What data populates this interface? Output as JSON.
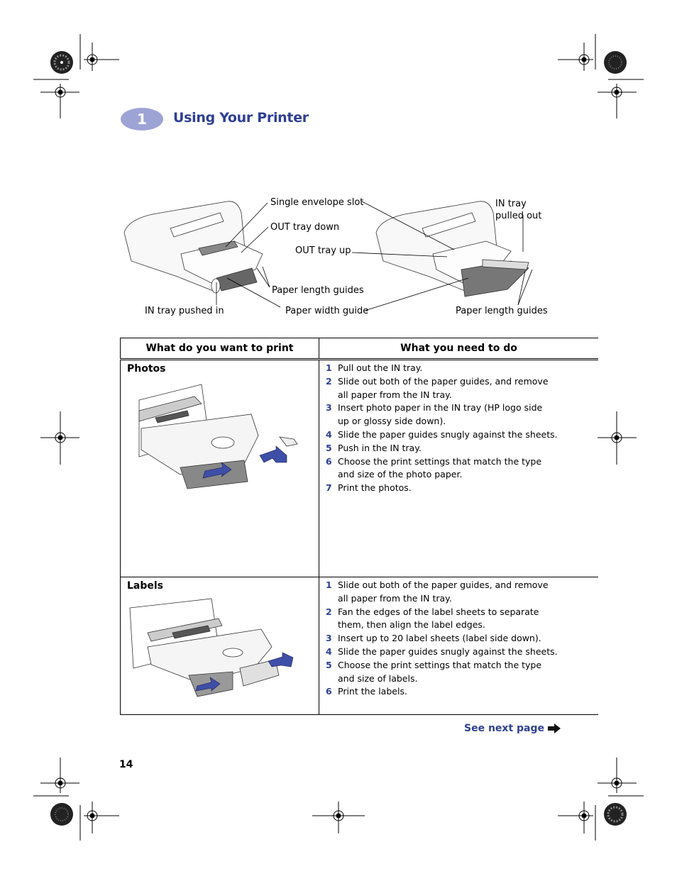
{
  "chapter": {
    "number": "1",
    "title": "Using Your Printer"
  },
  "figure": {
    "callouts": {
      "single_envelope_slot": "Single envelope slot",
      "out_tray_down": "OUT tray down",
      "out_tray_up": "OUT tray up",
      "paper_length_guides_left": "Paper length guides",
      "in_tray_pushed_in": "IN tray pushed in",
      "paper_width_guide": "Paper width guide",
      "in_tray_pulled_out": [
        "IN tray",
        "pulled out"
      ],
      "paper_length_guides_right": "Paper length guides"
    }
  },
  "table": {
    "headers": [
      "What do you want to print",
      "What you need to do"
    ],
    "rows": [
      {
        "item": "Photos",
        "steps": [
          {
            "n": "1",
            "text": "Pull out the IN tray."
          },
          {
            "n": "2",
            "text": "Slide out both of the paper guides, and remove all paper from the IN tray."
          },
          {
            "n": "3",
            "text": "Insert photo paper in the IN tray (HP logo side up or glossy side down)."
          },
          {
            "n": "4",
            "text": "Slide the paper guides snugly against the sheets."
          },
          {
            "n": "5",
            "text": "Push in the IN tray."
          },
          {
            "n": "6",
            "text": "Choose the print settings that match the type and size of the photo paper."
          },
          {
            "n": "7",
            "text": "Print the photos."
          }
        ]
      },
      {
        "item": "Labels",
        "steps": [
          {
            "n": "1",
            "text": "Slide out both of the paper guides, and remove all paper from the IN tray."
          },
          {
            "n": "2",
            "text": "Fan the edges of the label sheets to separate them, then align the label edges."
          },
          {
            "n": "3",
            "text": "Insert up to 20 label sheets (label side down)."
          },
          {
            "n": "4",
            "text": "Slide the paper guides snugly against the sheets."
          },
          {
            "n": "5",
            "text": "Choose the print settings that match the type and size of labels."
          },
          {
            "n": "6",
            "text": "Print the labels."
          }
        ]
      }
    ]
  },
  "footer": {
    "see_next": "See next page",
    "page_number": "14"
  },
  "colors": {
    "accent": "#2e3f94",
    "badge": "#9ea3d6",
    "arrow_blue": "#3e4fa8"
  }
}
